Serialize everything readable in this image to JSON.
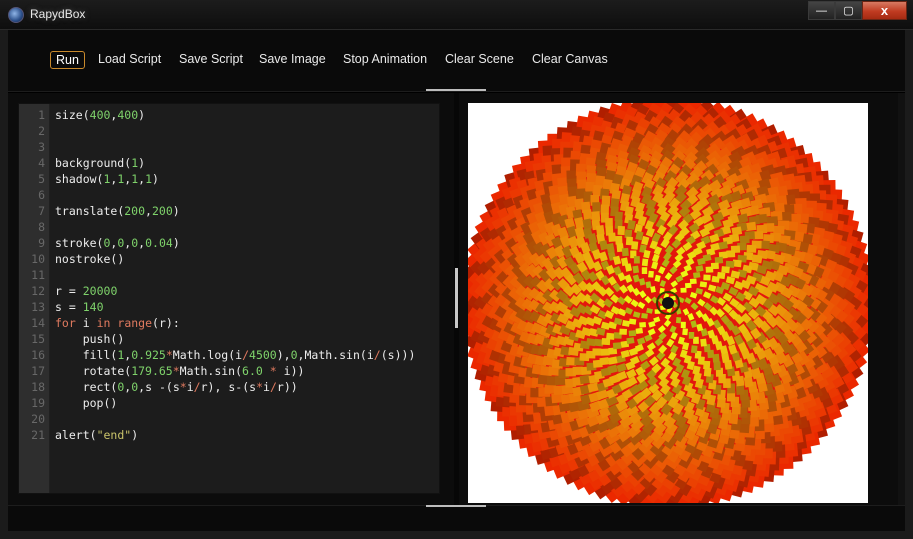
{
  "window": {
    "title": "RapydBox",
    "minimize_icon": "minimize-icon",
    "maximize_icon": "maximize-icon",
    "close_icon": "close-icon",
    "minimize_glyph": "—",
    "maximize_glyph": "▢",
    "close_glyph": "x"
  },
  "toolbar": {
    "run": "Run",
    "load_script": "Load Script",
    "save_script": "Save Script",
    "save_image": "Save Image",
    "stop_animation": "Stop Animation",
    "clear_scene": "Clear Scene",
    "clear_canvas": "Clear Canvas"
  },
  "editor": {
    "line_numbers": [
      "1",
      "2",
      "3",
      "4",
      "5",
      "6",
      "7",
      "8",
      "9",
      "10",
      "11",
      "12",
      "13",
      "14",
      "15",
      "16",
      "17",
      "18",
      "19",
      "20",
      "21"
    ],
    "lines": [
      "size(400,400)",
      "",
      "",
      "background(1)",
      "shadow(1,1,1,1)",
      "",
      "translate(200,200)",
      "",
      "stroke(0,0,0,0.04)",
      "nostroke()",
      "",
      "r = 20000",
      "s = 140",
      "for i in range(r):",
      "    push()",
      "    fill(1,0.925*Math.log(i/4500),0,Math.sin(i/(s)))",
      "    rotate(179.65*Math.sin(6.0 * i))",
      "    rect(0,0,s -(s*i/r), s-(s*i/r))",
      "    pop()",
      "",
      "alert(\"end\")"
    ]
  },
  "colors": {
    "number": "#7fd36b",
    "keyword": "#e07a5f",
    "string": "#c9c36a",
    "accent_button_border": "#c98a2c"
  }
}
